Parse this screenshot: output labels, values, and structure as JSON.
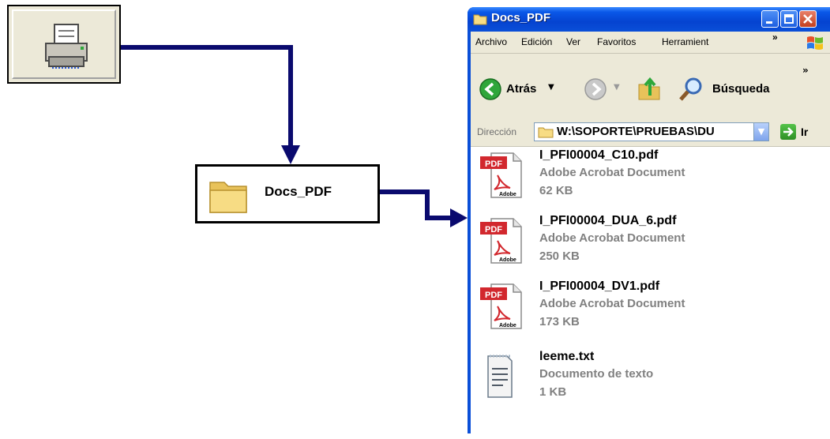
{
  "printer_button": {
    "icon": "printer-icon"
  },
  "folder_box": {
    "label": "Docs_PDF",
    "icon": "folder-icon"
  },
  "window": {
    "title": "Docs_PDF",
    "menu": [
      "Archivo",
      "Edición",
      "Ver",
      "Favoritos",
      "Herramient",
      "»"
    ],
    "toolbar": {
      "back_label": "Atrás",
      "search_label": "Búsqueda",
      "chevron": "»"
    },
    "address": {
      "label": "Dirección",
      "value": "W:\\SOPORTE\\PRUEBAS\\DU",
      "go_label": "Ir"
    },
    "files": [
      {
        "name": "I_PFI00004_C10.pdf",
        "type": "Adobe Acrobat Document",
        "size": "62 KB",
        "icon": "pdf-icon"
      },
      {
        "name": "I_PFI00004_DUA_6.pdf",
        "type": "Adobe Acrobat Document",
        "size": "250 KB",
        "icon": "pdf-icon"
      },
      {
        "name": "I_PFI00004_DV1.pdf",
        "type": "Adobe Acrobat Document",
        "size": "173 KB",
        "icon": "pdf-icon"
      },
      {
        "name": "leeme.txt",
        "type": "Documento de texto",
        "size": "1 KB",
        "icon": "text-document-icon"
      }
    ],
    "pdf_badge": "PDF",
    "adobe_badge": "Adobe"
  },
  "colors": {
    "arrow": "#0a0a6e",
    "titlebar": "#0a4fd8",
    "xp_face": "#ece9d8",
    "pdf_red": "#d2282e"
  }
}
